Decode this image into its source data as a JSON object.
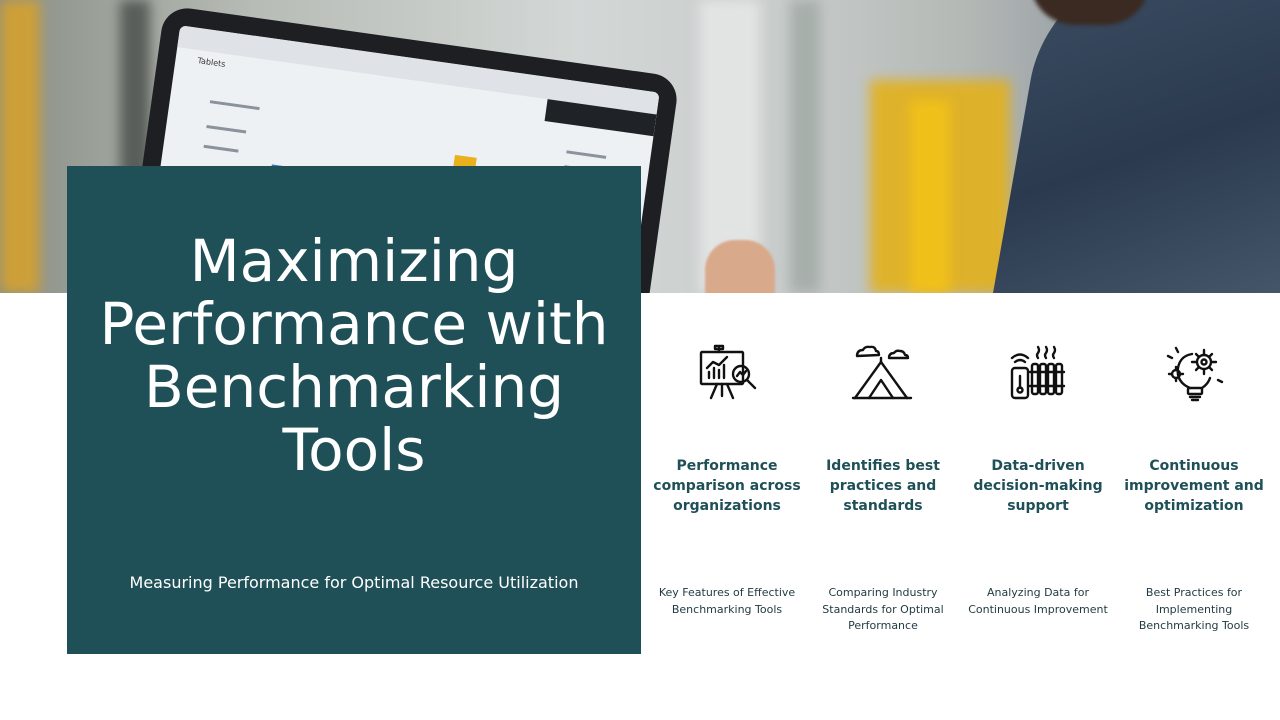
{
  "slide": {
    "title": "Maximizing Performance with Benchmarking Tools",
    "subtitle": "Measuring Performance for Optimal Resource Utilization",
    "accent_color": "#1f5058"
  },
  "hero_image": {
    "tablet_screen_label": "Tablets"
  },
  "features": [
    {
      "icon": "presentation-board-analytics-icon",
      "title": "Performance comparison across organizations",
      "description": "Key Features of Effective Benchmarking Tools"
    },
    {
      "icon": "tent-camp-icon",
      "title": "Identifies best practices and standards",
      "description": "Comparing Industry Standards for Optimal Performance"
    },
    {
      "icon": "thermostat-heater-icon",
      "title": "Data-driven decision-making support",
      "description": "Analyzing Data for Continuous Improvement"
    },
    {
      "icon": "lightbulb-gear-icon",
      "title": "Continuous improvement and optimization",
      "description": "Best Practices for Implementing Benchmarking Tools"
    }
  ]
}
